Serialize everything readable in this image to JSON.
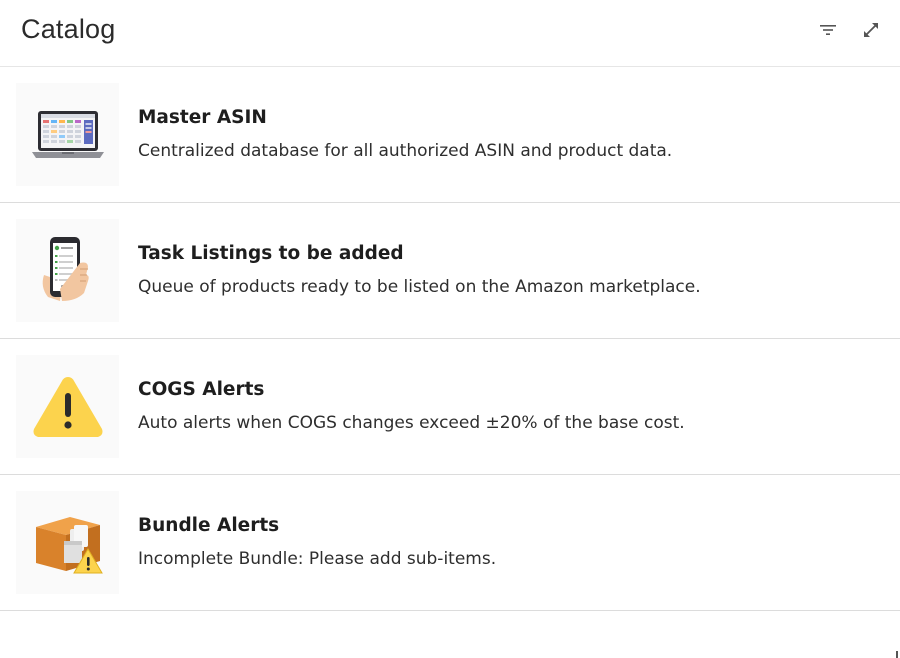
{
  "header": {
    "title": "Catalog",
    "filter_icon": "filter-icon",
    "expand_icon": "expand-icon"
  },
  "items": [
    {
      "title": "Master ASIN",
      "description": "Centralized database for all authorized ASIN and product data.",
      "icon": "laptop-icon"
    },
    {
      "title": "Task Listings to be added",
      "description": "Queue of products ready to be listed on the Amazon marketplace.",
      "icon": "phone-checklist-icon"
    },
    {
      "title": "COGS Alerts",
      "description": "Auto alerts when COGS changes exceed ±20% of the base cost.",
      "icon": "warning-icon"
    },
    {
      "title": "Bundle Alerts",
      "description": "Incomplete Bundle: Please add sub-items.",
      "icon": "box-warning-icon"
    }
  ],
  "colors": {
    "warning_yellow": "#fcd34d",
    "box_orange": "#e08a2e",
    "divider": "#dcdcdc"
  }
}
